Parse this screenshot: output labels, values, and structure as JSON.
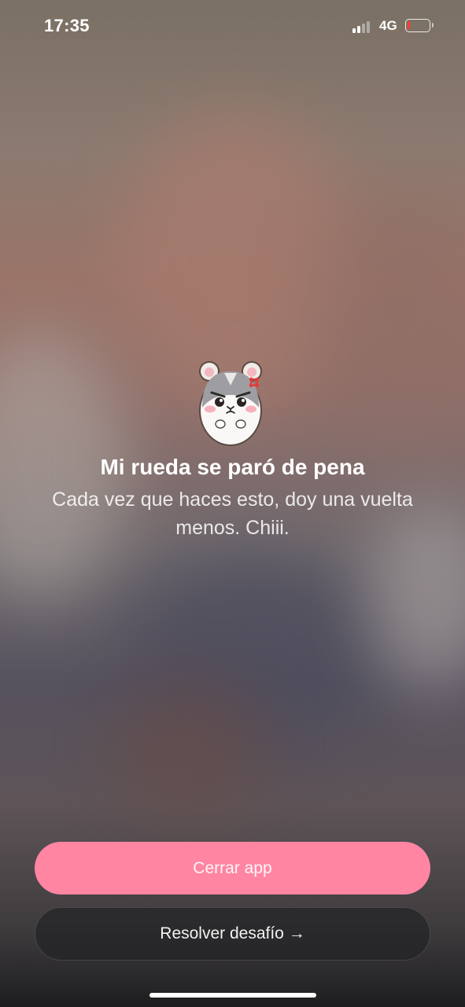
{
  "status_bar": {
    "time": "17:35",
    "network": "4G",
    "signal_bars_active": 2,
    "signal_bars_total": 4,
    "battery_level": 0.05,
    "battery_color": "#ff3b30"
  },
  "mascot": {
    "icon": "angry-hamster-icon"
  },
  "content": {
    "title": "Mi rueda se paró de pena",
    "message": "Cada vez que haces esto, doy una vuelta menos. Chiii."
  },
  "buttons": {
    "close_label": "Cerrar app",
    "solve_label": "Resolver desafío →"
  },
  "colors": {
    "accent": "#ff85a2"
  }
}
